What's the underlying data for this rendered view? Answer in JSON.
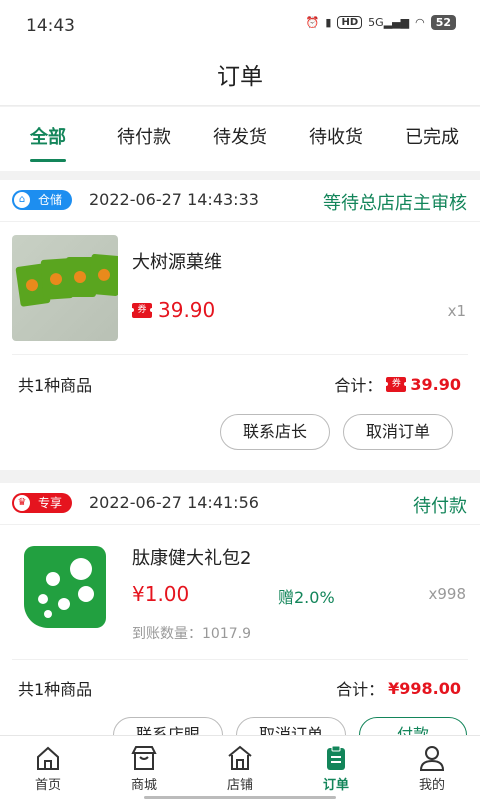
{
  "statusbar": {
    "time": "14:43",
    "hd": "HD",
    "signal": "5G",
    "battery": "52"
  },
  "header": {
    "title": "订单"
  },
  "tabs": [
    {
      "label": "全部",
      "active": true
    },
    {
      "label": "待付款",
      "active": false
    },
    {
      "label": "待发货",
      "active": false
    },
    {
      "label": "待收货",
      "active": false
    },
    {
      "label": "已完成",
      "active": false
    }
  ],
  "orders": [
    {
      "badge": "仓储",
      "badge_icon": "home-icon",
      "badge_color": "#1d8ef0",
      "datetime": "2022-06-27 14:43:33",
      "status": "等待总店店主审核",
      "product_name": "大树源菓维",
      "coupon_icon_text": "券",
      "price": "39.90",
      "qty": "x1",
      "count_text": "共1种商品",
      "total_label": "合计：",
      "total_amount": "39.90",
      "buttons": [
        "联系店长",
        "取消订单"
      ]
    },
    {
      "badge": "专享",
      "badge_icon": "crown-icon",
      "badge_color": "#e5141e",
      "datetime": "2022-06-27 14:41:56",
      "status": "待付款",
      "product_name": "肽康健大礼包2",
      "price": "¥1.00",
      "gift": "赠2.0%",
      "qty": "x998",
      "arrival": "到账数量：1017.9",
      "count_text": "共1种商品",
      "total_label": "合计：",
      "total_amount": "¥998.00",
      "buttons": [
        "联系店眼",
        "取消订单",
        "付款"
      ]
    }
  ],
  "bottomnav": [
    {
      "label": "首页",
      "icon": "home-icon",
      "active": false
    },
    {
      "label": "商城",
      "icon": "store-icon",
      "active": false
    },
    {
      "label": "店铺",
      "icon": "shop-icon",
      "active": false
    },
    {
      "label": "订单",
      "icon": "order-icon",
      "active": true
    },
    {
      "label": "我的",
      "icon": "user-icon",
      "active": false
    }
  ],
  "colors": {
    "accent": "#13855a",
    "price": "#e5141e",
    "badge_blue": "#1d8ef0",
    "badge_red": "#e5141e"
  }
}
